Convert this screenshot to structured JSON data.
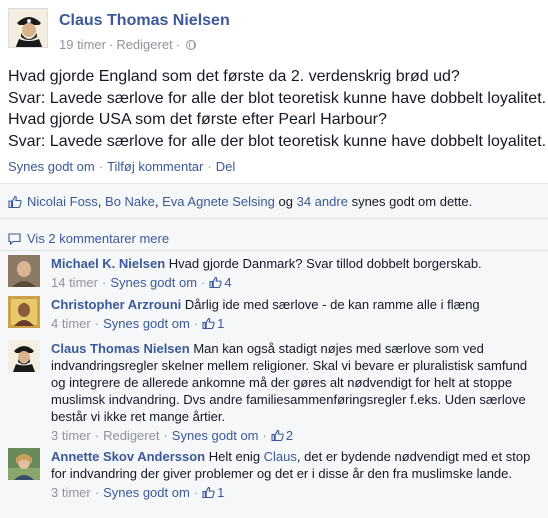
{
  "post": {
    "author": "Claus Thomas Nielsen",
    "time": "19 timer",
    "edited": "Redigeret",
    "lines": [
      "Hvad gjorde England som det første da 2. verdenskrig brød ud?",
      "Svar: Lavede særlove for alle der blot teoretisk kunne have dobbelt loyalitet.",
      "Hvad gjorde USA som det første efter Pearl Harbour?",
      "Svar: Lavede særlove for alle der blot teoretisk kunne have dobbelt loyalitet."
    ],
    "actions": {
      "like": "Synes godt om",
      "comment": "Tilføj kommentar",
      "share": "Del"
    }
  },
  "likes": {
    "name1": "Nicolai Foss",
    "name2": "Bo Nake",
    "name3": "Eva Agnete Selsing",
    "og": "og",
    "others": "34 andre",
    "suffix": "synes godt om dette."
  },
  "view_more": "Vis 2 kommentarer mere",
  "comments": [
    {
      "author": "Michael K. Nielsen",
      "text": "Hvad gjorde Danmark? Svar tillod dobbelt borgerskab.",
      "time": "14 timer",
      "like": "Synes godt om",
      "likes": "4"
    },
    {
      "author": "Christopher Arzrouni",
      "text": "Dårlig ide med særlove - de kan ramme alle i flæng",
      "time": "4 timer",
      "like": "Synes godt om",
      "likes": "1"
    },
    {
      "author": "Claus Thomas Nielsen",
      "text": "Man kan også stadigt nøjes med særlove som ved indvandringsregler skelner mellem religioner. Skal vi bevare er pluralistisk samfund og integrere de allerede ankomne må der gøres alt nødvendigt for helt at stoppe muslimsk indvandring. Dvs andre familiesammenføringsregler f.eks. Uden særlove består vi ikke ret mange årtier.",
      "time": "3 timer",
      "edited": "Redigeret",
      "like": "Synes godt om",
      "likes": "2"
    },
    {
      "author": "Annette Skov Andersson",
      "text_pre": "Helt enig ",
      "mention": "Claus",
      "text_post": ", det er bydende nødvendigt med et stop for indvandring der giver problemer og det er i disse år den fra muslimske lande.",
      "time": "3 timer",
      "like": "Synes godt om",
      "likes": "1"
    }
  ],
  "icons": {
    "globe": "globe-icon",
    "thumb": "thumbs-up-icon",
    "bubble": "comment-bubble-icon"
  },
  "colors": {
    "link": "#3b5998",
    "meta": "#90949c",
    "panel": "#f6f7f9"
  }
}
